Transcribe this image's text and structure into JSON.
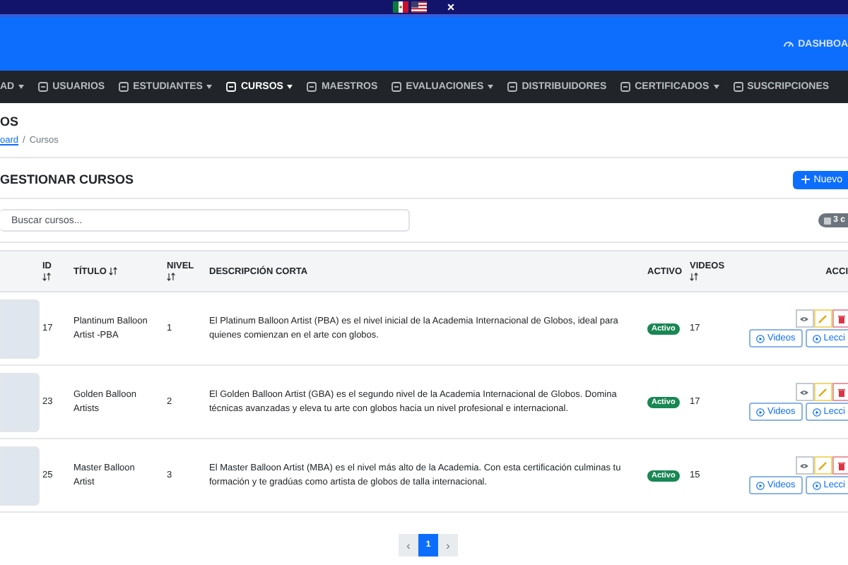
{
  "top_bar": {
    "close": "×"
  },
  "header": {
    "dashboard_link": "DASHBOA"
  },
  "nav": [
    {
      "label": "AD",
      "dropdown": true,
      "selected": false,
      "icon": false
    },
    {
      "label": "USUARIOS",
      "dropdown": false,
      "selected": false,
      "icon": true
    },
    {
      "label": "ESTUDIANTES",
      "dropdown": true,
      "selected": false,
      "icon": true
    },
    {
      "label": "CURSOS",
      "dropdown": true,
      "selected": true,
      "icon": true
    },
    {
      "label": "MAESTROS",
      "dropdown": false,
      "selected": false,
      "icon": true
    },
    {
      "label": "EVALUACIONES",
      "dropdown": true,
      "selected": false,
      "icon": true
    },
    {
      "label": "DISTRIBUIDORES",
      "dropdown": false,
      "selected": false,
      "icon": true
    },
    {
      "label": "CERTIFICADOS",
      "dropdown": true,
      "selected": false,
      "icon": true
    },
    {
      "label": "SUSCRIPCIONES",
      "dropdown": false,
      "selected": false,
      "icon": true
    }
  ],
  "page_title": "OS",
  "breadcrumb": {
    "link": "oard",
    "separator": "/",
    "current": "Cursos"
  },
  "card": {
    "title": "GESTIONAR CURSOS",
    "new_button": "Nuevo",
    "search": {
      "placeholder": "Buscar cursos..."
    },
    "count_badge": "3 c"
  },
  "table": {
    "columns": [
      {
        "label": "ID",
        "sortable": true
      },
      {
        "label": "TÍTULO",
        "sortable": true
      },
      {
        "label": "NIVEL",
        "sortable": true
      },
      {
        "label": "DESCRIPCIÓN CORTA",
        "sortable": false
      },
      {
        "label": "ACTIVO",
        "sortable": false
      },
      {
        "label": "VIDEOS",
        "sortable": true
      },
      {
        "label": "ACCI",
        "sortable": false
      }
    ],
    "rows": [
      {
        "id": "17",
        "title": "Plantinum Balloon Artist -PBA",
        "level": "1",
        "description": "El Platinum Balloon Artist (PBA) es el nivel inicial de la Academia Internacional de Globos, ideal para quienes comienzan en el arte con globos.",
        "status": "Activo",
        "videos": "17",
        "videos_button": "Videos",
        "lessons_button": "Lecci"
      },
      {
        "id": "23",
        "title": "Golden Balloon Artists",
        "level": "2",
        "description": "El Golden Balloon Artist (GBA) es el segundo nivel de la Academia Internacional de Globos. Domina técnicas avanzadas y eleva tu arte con globos hacia un nivel profesional e internacional.",
        "status": "Activo",
        "videos": "17",
        "videos_button": "Videos",
        "lessons_button": "Lecci"
      },
      {
        "id": "25",
        "title": "Master Balloon Artist",
        "level": "3",
        "description": "El Master Balloon Artist (MBA) es el nivel más alto de la Academia. Con esta certificación culminas tu formación y te gradúas como artista de globos de talla internacional.",
        "status": "Activo",
        "videos": "15",
        "videos_button": "Videos",
        "lessons_button": "Lecci"
      }
    ]
  },
  "pagination": {
    "prev": "‹",
    "pages": [
      {
        "label": "1",
        "selected": true
      }
    ],
    "next": "›"
  }
}
